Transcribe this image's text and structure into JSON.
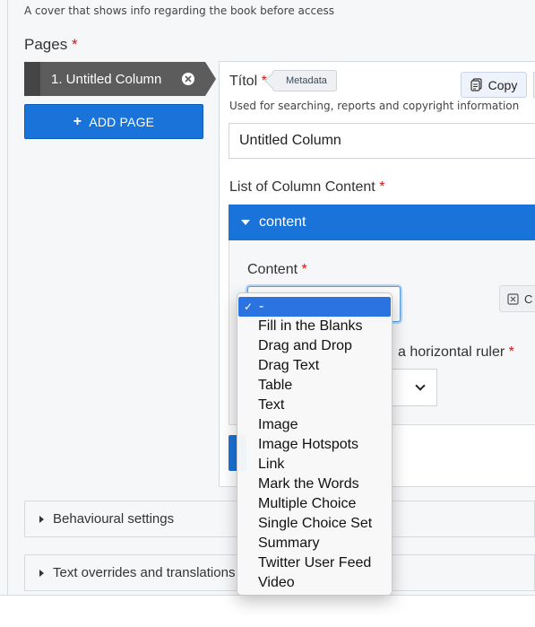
{
  "cover_description": "A cover that shows info regarding the book before access",
  "pages": {
    "label": "Pages",
    "required_mark": "*",
    "tab_label": "1. Untitled Column",
    "add_page_label": "ADD PAGE",
    "add_page_icon": "+"
  },
  "title_field": {
    "label": "Títol",
    "required_mark": "*",
    "badge": "Metadata",
    "copy_label": "Copy",
    "helper": "Used for searching, reports and copyright information",
    "value": "Untitled Column"
  },
  "list_content": {
    "label": "List of Column Content",
    "required_mark": "*",
    "group_title": "content"
  },
  "content_field": {
    "label": "Content",
    "required_mark": "*",
    "clear_label": "C"
  },
  "ruler_field": {
    "label_fragment": "a horizontal ruler",
    "required_mark": "*"
  },
  "accordions": [
    {
      "label": "Behavioural settings"
    },
    {
      "label": "Text overrides and translations"
    }
  ],
  "dropdown": {
    "check_mark": "✓",
    "selected_index": 0,
    "options": [
      "-",
      "Fill in the Blanks",
      "Drag and Drop",
      "Drag Text",
      "Table",
      "Text",
      "Image",
      "Image Hotspots",
      "Link",
      "Mark the Words",
      "Multiple Choice",
      "Single Choice Set",
      "Summary",
      "Twitter User Feed",
      "Video"
    ]
  },
  "colors": {
    "accent": "#1a73d9",
    "tab_bg": "#5c5c5c",
    "required": "#c51a1a"
  }
}
